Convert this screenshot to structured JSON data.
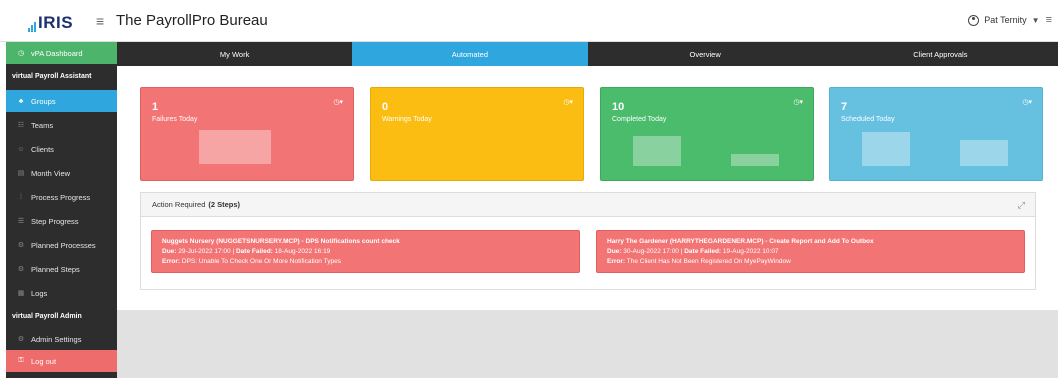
{
  "header": {
    "logo": "IRIS",
    "title": "The PayrollPro Bureau",
    "user_name": "Pat Ternity"
  },
  "sidebar": {
    "dashboard": "vPA Dashboard",
    "section_assistant": "virtual Payroll Assistant",
    "items": [
      {
        "label": "Groups",
        "icon": "groups-icon"
      },
      {
        "label": "Teams",
        "icon": "teams-icon"
      },
      {
        "label": "Clients",
        "icon": "clients-icon"
      },
      {
        "label": "Month View",
        "icon": "calendar-icon"
      },
      {
        "label": "Process Progress",
        "icon": "progress-icon"
      },
      {
        "label": "Step Progress",
        "icon": "list-icon"
      },
      {
        "label": "Planned Processes",
        "icon": "gear-icon"
      },
      {
        "label": "Planned Steps",
        "icon": "gear-icon"
      },
      {
        "label": "Logs",
        "icon": "logs-icon"
      }
    ],
    "section_admin": "virtual Payroll Admin",
    "admin_settings": "Admin Settings",
    "logout": "Log out"
  },
  "tabs": [
    "My Work",
    "Automated",
    "Overview",
    "Client Approvals"
  ],
  "active_tab": "Automated",
  "cards": [
    {
      "value": "1",
      "label": "Failures Today",
      "color": "#f27474"
    },
    {
      "value": "0",
      "label": "Warnings Today",
      "color": "#fbbd11"
    },
    {
      "value": "10",
      "label": "Completed Today",
      "color": "#4bbb6c"
    },
    {
      "value": "7",
      "label": "Scheduled Today",
      "color": "#66c0e0"
    }
  ],
  "action_panel": {
    "title": "Action Required",
    "steps": "(2 Steps)",
    "alerts": [
      {
        "title": "Nuggets Nursery (NUGGETSNURSERY.MCP) - DPS Notifications count check",
        "due_label": "Due:",
        "due": "29-Jul-2022 17:00",
        "failed_label": "Date Failed:",
        "failed": "18-Aug-2022 16:19",
        "error_label": "Error:",
        "error": "DPS: Unable To Check One Or More Notification Types"
      },
      {
        "title": "Harry The Gardener (HARRYTHEGARDENER.MCP) - Create Report and Add To Outbox",
        "due_label": "Due:",
        "due": "30-Aug-2022 17:00",
        "failed_label": "Date Failed:",
        "failed": "19-Aug-2022 10:07",
        "error_label": "Error:",
        "error": "The Client Has Not Been Registered On MyePayWindow"
      }
    ]
  },
  "colors": {
    "accent_blue": "#2fa6dd",
    "success_green": "#4cb56b",
    "danger_red": "#ef6c6c",
    "sidebar_dark": "#2d2d2d"
  }
}
